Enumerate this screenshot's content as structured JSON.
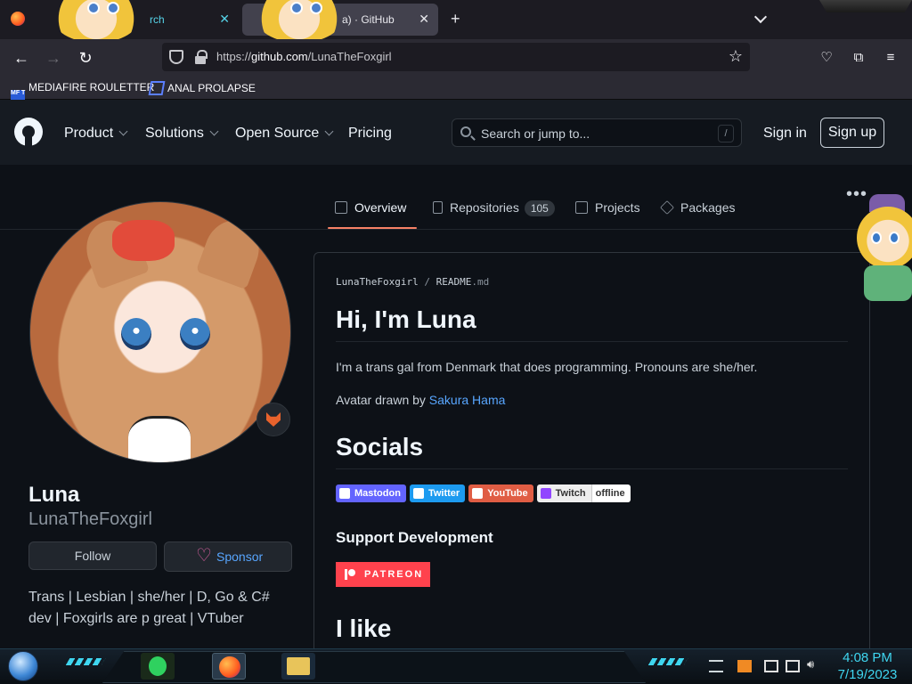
{
  "browser": {
    "tabs": [
      {
        "title": "rch"
      },
      {
        "title": "a) · GitHub"
      }
    ],
    "tab_close": "✕",
    "new_tab": "+",
    "url_prefix": "https://",
    "url_domain": "github.com",
    "url_path": "/LunaTheFoxgirl",
    "bookmarks": [
      {
        "label": "MEDIAFIRE ROULETTER",
        "icon_text": "MF T"
      },
      {
        "label": "ANAL PROLAPSE"
      }
    ]
  },
  "github": {
    "nav": [
      "Product",
      "Solutions",
      "Open Source",
      "Pricing"
    ],
    "search_placeholder": "Search or jump to...",
    "search_shortcut": "/",
    "signin": "Sign in",
    "signup": "Sign up"
  },
  "profile": {
    "tabs": {
      "overview": "Overview",
      "repositories": "Repositories",
      "repo_count": "105",
      "projects": "Projects",
      "packages": "Packages"
    },
    "more": "•••",
    "name": "Luna",
    "username": "LunaTheFoxgirl",
    "follow": "Follow",
    "sponsor": "Sponsor",
    "bio": "Trans | Lesbian | she/her | D, Go & C# dev | Foxgirls are p great | VTuber"
  },
  "readme": {
    "path_user": "LunaTheFoxgirl",
    "path_sep": "/",
    "path_file": "README",
    "path_ext": ".md",
    "heading": "Hi, I'm Luna",
    "intro": "I'm a trans gal from Denmark that does programming. Pronouns are she/her.",
    "avatar_prefix": "Avatar drawn by ",
    "avatar_artist": "Sakura Hama",
    "socials_heading": "Socials",
    "badges": {
      "mastodon": "Mastodon",
      "twitter": "Twitter",
      "youtube": "YouTube",
      "twitch": "Twitch",
      "twitch_status": "offline"
    },
    "support_heading": "Support Development",
    "patreon": "PATREON",
    "like_heading": "I like"
  },
  "taskbar": {
    "time": "4:08 PM",
    "date": "7/19/2023"
  },
  "colors": {
    "accent_link": "#58a6ff",
    "tab_underline": "#f78166",
    "patreon": "#ff424d",
    "clock": "#3fd6f0"
  }
}
